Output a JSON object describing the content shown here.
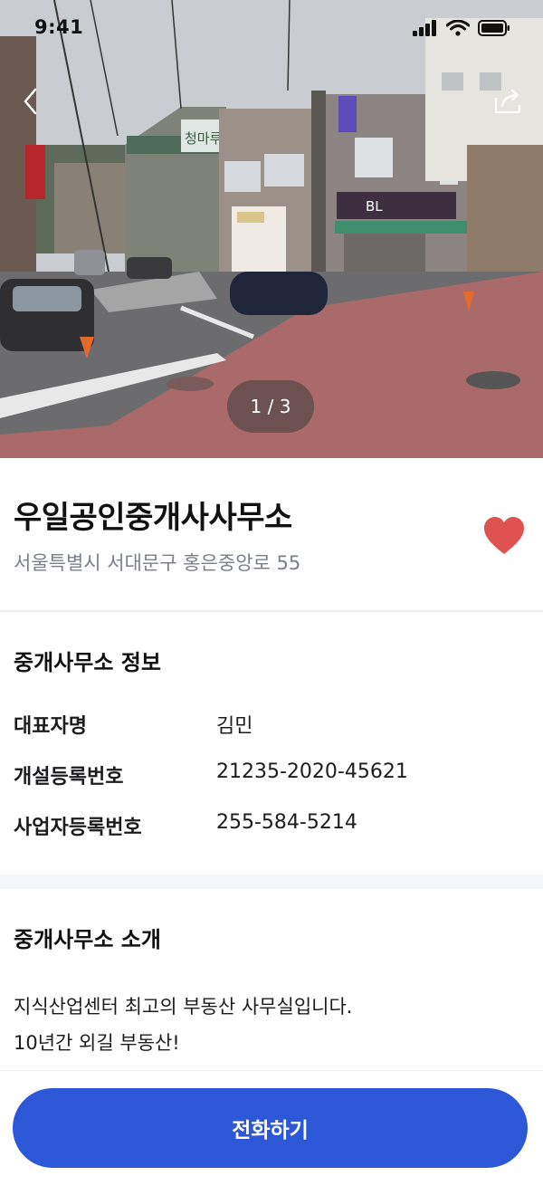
{
  "status_bar": {
    "time": "9:41"
  },
  "hero": {
    "photo_counter": "1 / 3",
    "sign_text_1": "청마루",
    "sign_text_2": "BL"
  },
  "office": {
    "name": "우일공인중개사사무소",
    "address": "서울특별시 서대문구 홍은중앙로 55",
    "favorited": true
  },
  "info": {
    "title": "중개사무소 정보",
    "rows": [
      {
        "label": "대표자명",
        "value": "김민"
      },
      {
        "label": "개설등록번호",
        "value": "21235-2020-45621"
      },
      {
        "label": "사업자등록번호",
        "value": "255-584-5214"
      }
    ]
  },
  "intro": {
    "title": "중개사무소 소개",
    "line1": "지식산업센터 최고의 부동산 사무실입니다.",
    "line2": "10년간 외길 부동산!"
  },
  "bottom": {
    "call_label": "전화하기"
  },
  "colors": {
    "accent": "#2c57d6",
    "heart": "#e0524f",
    "address_gray": "#7b7f89"
  }
}
